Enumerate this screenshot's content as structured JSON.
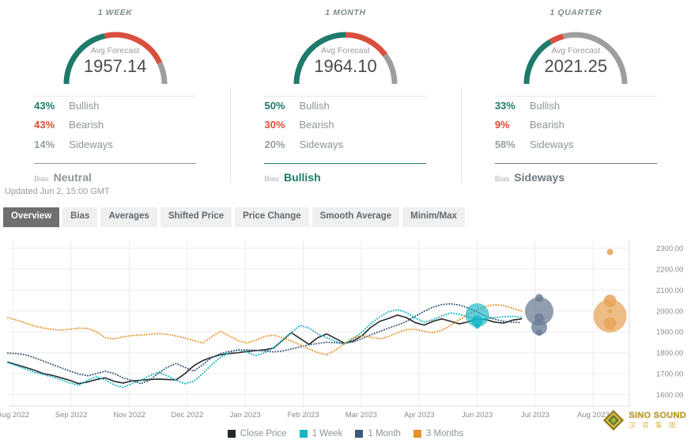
{
  "cards": [
    {
      "title": "1 WEEK",
      "gauge_label": "Avg Forecast",
      "value": "1957.14",
      "bullish_pct": "43%",
      "bullish_label": "Bullish",
      "bearish_pct": "43%",
      "bearish_label": "Bearish",
      "sideways_pct": "14%",
      "sideways_label": "Sideways",
      "bias_word": "Bias",
      "bias_value": "Neutral",
      "bias_color": "#8d9599",
      "arc": {
        "green": 43,
        "red": 43,
        "gray": 14
      }
    },
    {
      "title": "1 MONTH",
      "gauge_label": "Avg Forecast",
      "value": "1964.10",
      "bullish_pct": "50%",
      "bullish_label": "Bullish",
      "bearish_pct": "30%",
      "bearish_label": "Bearish",
      "sideways_pct": "20%",
      "sideways_label": "Sideways",
      "bias_word": "Bias",
      "bias_value": "Bullish",
      "bias_color": "#1e7a6a",
      "arc": {
        "green": 50,
        "red": 30,
        "gray": 20
      }
    },
    {
      "title": "1 QUARTER",
      "gauge_label": "Avg Forecast",
      "value": "2021.25",
      "bullish_pct": "33%",
      "bullish_label": "Bullish",
      "bearish_pct": "9%",
      "bearish_label": "Bearish",
      "sideways_pct": "58%",
      "sideways_label": "Sideways",
      "bias_word": "Bias",
      "bias_value": "Sideways",
      "bias_color": "#6f7b80",
      "arc": {
        "green": 33,
        "red": 9,
        "gray": 58
      }
    }
  ],
  "updated": "Updated Jun 2, 15:00 GMT",
  "tabs": [
    {
      "label": "Overview",
      "active": true
    },
    {
      "label": "Bias",
      "active": false
    },
    {
      "label": "Averages",
      "active": false
    },
    {
      "label": "Shifted Price",
      "active": false
    },
    {
      "label": "Price Change",
      "active": false
    },
    {
      "label": "Smooth Average",
      "active": false
    },
    {
      "label": "Minim/Max",
      "active": false
    }
  ],
  "colors": {
    "green": "#1e7a6a",
    "red": "#d94f3d",
    "gray": "#9e9e9e",
    "close_price": "#26292b",
    "one_week": "#16b6c4",
    "one_month": "#3d5a7a",
    "three_months": "#e8922e",
    "grid": "#ededed"
  },
  "watermark": {
    "en": "SINO SOUND",
    "cn": "汉 音 集 团"
  },
  "chart_data": {
    "type": "line",
    "title": "",
    "xlabel": "",
    "ylabel": "",
    "ylim": [
      1560,
      2340
    ],
    "grid": true,
    "legend_position": "bottom",
    "ytick_labels": [
      "2300.00",
      "2200.00",
      "2100.00",
      "2000.00",
      "1900.00",
      "1800.00",
      "1700.00",
      "1600.00"
    ],
    "ytick_values": [
      2300,
      2200,
      2100,
      2000,
      1900,
      1800,
      1700,
      1600
    ],
    "xtick_labels": [
      "Aug 2022",
      "Sep 2022",
      "Nov 2022",
      "Dec 2022",
      "Jan 2023",
      "Feb 2023",
      "Mar 2023",
      "Apr 2023",
      "Jun 2023",
      "Jul 2023",
      "Aug 2023"
    ],
    "legend": [
      {
        "name": "Close Price",
        "color": "#26292b"
      },
      {
        "name": "1 Week",
        "color": "#16b6c4"
      },
      {
        "name": "1 Month",
        "color": "#3d5a7a"
      },
      {
        "name": "3 Months",
        "color": "#e8922e"
      }
    ],
    "series": [
      {
        "name": "Close Price",
        "color": "#26292b",
        "style": "solid",
        "values": [
          1755,
          1742,
          1730,
          1716,
          1700,
          1692,
          1680,
          1668,
          1652,
          1660,
          1672,
          1680,
          1663,
          1655,
          1665,
          1668,
          1672,
          1674,
          1672,
          1670,
          1700,
          1738,
          1762,
          1778,
          1790,
          1796,
          1800,
          1806,
          1810,
          1814,
          1822,
          1858,
          1896,
          1868,
          1840,
          1872,
          1890,
          1868,
          1846,
          1856,
          1882,
          1922,
          1950,
          1964,
          1980,
          1968,
          1944,
          1932,
          1950,
          1962,
          1950,
          1938,
          1948,
          1962,
          1958,
          1946,
          1942,
          1956,
          1962
        ]
      },
      {
        "name": "1 Week",
        "color": "#16b6c4",
        "style": "dotted",
        "values": [
          1752,
          1738,
          1722,
          1706,
          1696,
          1684,
          1670,
          1656,
          1644,
          1668,
          1686,
          1670,
          1646,
          1634,
          1652,
          1668,
          1690,
          1706,
          1690,
          1668,
          1652,
          1664,
          1700,
          1742,
          1778,
          1800,
          1816,
          1802,
          1786,
          1800,
          1824,
          1860,
          1896,
          1930,
          1918,
          1890,
          1872,
          1854,
          1842,
          1866,
          1900,
          1940,
          1972,
          1996,
          2006,
          1992,
          1966,
          1946,
          1958,
          1976,
          1990,
          1984,
          1970,
          1960,
          1962,
          1968,
          1972,
          1974,
          1970
        ]
      },
      {
        "name": "1 Month",
        "color": "#3d5a7a",
        "style": "dotted",
        "values": [
          1798,
          1796,
          1790,
          1776,
          1760,
          1744,
          1728,
          1712,
          1698,
          1690,
          1700,
          1712,
          1700,
          1680,
          1668,
          1652,
          1668,
          1702,
          1730,
          1748,
          1730,
          1712,
          1742,
          1776,
          1796,
          1806,
          1812,
          1814,
          1812,
          1808,
          1804,
          1808,
          1818,
          1828,
          1838,
          1844,
          1850,
          1848,
          1844,
          1852,
          1868,
          1886,
          1902,
          1918,
          1932,
          1950,
          1974,
          1998,
          2018,
          2030,
          2034,
          2028,
          2014,
          1996,
          1974,
          1960,
          1950,
          1946,
          1944
        ]
      },
      {
        "name": "3 Months",
        "color": "#e8922e",
        "style": "dotted",
        "values": [
          1968,
          1956,
          1942,
          1928,
          1918,
          1912,
          1908,
          1912,
          1918,
          1916,
          1900,
          1872,
          1866,
          1876,
          1882,
          1884,
          1888,
          1892,
          1888,
          1880,
          1870,
          1858,
          1846,
          1876,
          1902,
          1880,
          1858,
          1846,
          1860,
          1878,
          1884,
          1872,
          1856,
          1838,
          1818,
          1800,
          1790,
          1812,
          1844,
          1872,
          1882,
          1874,
          1866,
          1878,
          1896,
          1910,
          1912,
          1902,
          1896,
          1908,
          1930,
          1958,
          1984,
          2006,
          2022,
          2030,
          2026,
          2012,
          2000
        ]
      }
    ],
    "forecast_bubbles": [
      {
        "series": "1 Week",
        "color": "#16b6c4",
        "x_index": 53,
        "value": 1980,
        "size": 30,
        "opacity": 0.65
      },
      {
        "series": "1 Week",
        "color": "#16b6c4",
        "x_index": 53,
        "value": 1952,
        "size": 14,
        "opacity": 0.8
      },
      {
        "series": "1 Week",
        "color": "#16b6c4",
        "x_index": 53,
        "value": 1928,
        "size": 7,
        "opacity": 0.85
      },
      {
        "series": "1 Month",
        "color": "#6b7e96",
        "x_index": 60,
        "value": 2062,
        "size": 10,
        "opacity": 0.85
      },
      {
        "series": "1 Month",
        "color": "#6b7e96",
        "x_index": 60,
        "value": 1998,
        "size": 36,
        "opacity": 0.75
      },
      {
        "series": "1 Month",
        "color": "#6b7e96",
        "x_index": 60,
        "value": 1966,
        "size": 12,
        "opacity": 0.85
      },
      {
        "series": "1 Month",
        "color": "#6b7e96",
        "x_index": 60,
        "value": 1922,
        "size": 20,
        "opacity": 0.8
      },
      {
        "series": "1 Month",
        "color": "#6b7e96",
        "x_index": 60,
        "value": 1896,
        "size": 8,
        "opacity": 0.85
      },
      {
        "series": "3 Months",
        "color": "#e8a55c",
        "x_index": 68,
        "value": 2282,
        "size": 8,
        "opacity": 0.9
      },
      {
        "series": "3 Months",
        "color": "#e8a55c",
        "x_index": 68,
        "value": 2048,
        "size": 16,
        "opacity": 0.85
      },
      {
        "series": "3 Months",
        "color": "#e8a55c",
        "x_index": 68,
        "value": 1998,
        "size": 5,
        "opacity": 0.9
      },
      {
        "series": "3 Months",
        "color": "#e8a55c",
        "x_index": 68,
        "value": 1976,
        "size": 42,
        "opacity": 0.75
      },
      {
        "series": "3 Months",
        "color": "#e8a55c",
        "x_index": 68,
        "value": 1940,
        "size": 16,
        "opacity": 0.85
      }
    ]
  }
}
